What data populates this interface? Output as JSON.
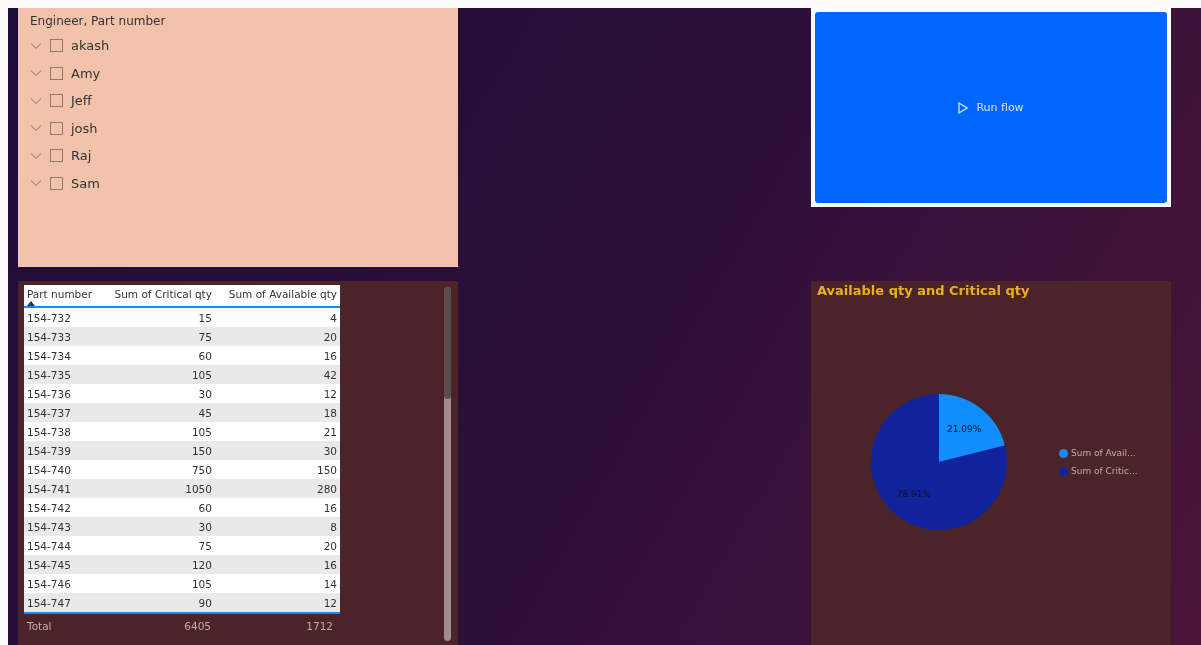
{
  "slicer": {
    "title": "Engineer, Part number",
    "items": [
      {
        "label": "akash",
        "checked": false
      },
      {
        "label": "Amy",
        "checked": false
      },
      {
        "label": "Jeff",
        "checked": false
      },
      {
        "label": "josh",
        "checked": false
      },
      {
        "label": "Raj",
        "checked": false
      },
      {
        "label": "Sam",
        "checked": false
      }
    ]
  },
  "flow_button": {
    "label": "Run flow"
  },
  "table": {
    "columns": [
      "Part number",
      "Sum of Critical qty",
      "Sum of Available qty"
    ],
    "rows": [
      [
        "154-732",
        "15",
        "4"
      ],
      [
        "154-733",
        "75",
        "20"
      ],
      [
        "154-734",
        "60",
        "16"
      ],
      [
        "154-735",
        "105",
        "42"
      ],
      [
        "154-736",
        "30",
        "12"
      ],
      [
        "154-737",
        "45",
        "18"
      ],
      [
        "154-738",
        "105",
        "21"
      ],
      [
        "154-739",
        "150",
        "30"
      ],
      [
        "154-740",
        "750",
        "150"
      ],
      [
        "154-741",
        "1050",
        "280"
      ],
      [
        "154-742",
        "60",
        "16"
      ],
      [
        "154-743",
        "30",
        "8"
      ],
      [
        "154-744",
        "75",
        "20"
      ],
      [
        "154-745",
        "120",
        "16"
      ],
      [
        "154-746",
        "105",
        "14"
      ],
      [
        "154-747",
        "90",
        "12"
      ]
    ],
    "total": [
      "Total",
      "6405",
      "1712"
    ]
  },
  "pie_chart": {
    "chart_data": {
      "type": "pie",
      "title": "Available qty and Critical qty",
      "categories": [
        "Sum of Avail...",
        "Sum of Critic..."
      ],
      "values": [
        21.09,
        78.91
      ],
      "legend": "right",
      "value_labels": [
        "21.09%",
        "78.91%"
      ],
      "colors": [
        "#118dff",
        "#12239e"
      ]
    }
  }
}
